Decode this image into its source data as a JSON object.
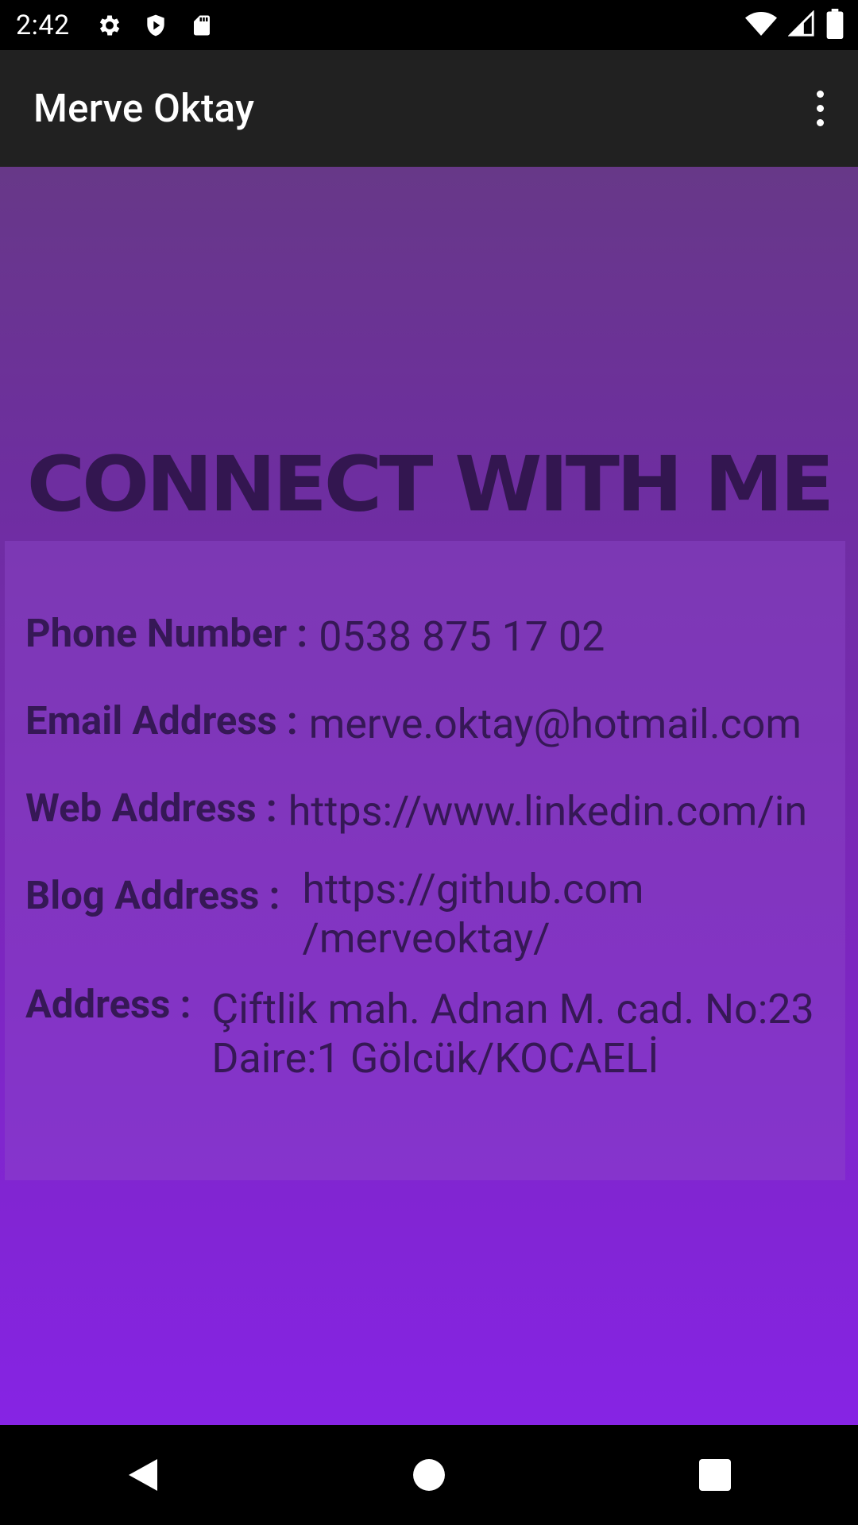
{
  "status_bar": {
    "time": "2:42",
    "icons": [
      "gear-icon",
      "shield-icon",
      "sd-card-icon",
      "wifi-icon",
      "cell-signal-icon",
      "battery-icon"
    ]
  },
  "app_bar": {
    "title": "Merve Oktay",
    "menu_icon": "more-vert-icon"
  },
  "main": {
    "heading": "CONNECT WITH ME",
    "contacts": [
      {
        "label": "Phone Number :",
        "value": "0538 875 17 02"
      },
      {
        "label": "Email Address :",
        "value": "merve.oktay@hotmail.com"
      },
      {
        "label": "Web Address :",
        "value": "https://www.linkedin.com/in"
      },
      {
        "label": "Blog Address :",
        "value_line1": "https://github.com",
        "value_line2": "/merveoktay/"
      },
      {
        "label": "Address :",
        "value_line1": "Çiftlik mah. Adnan M. cad. No:23",
        "value_line2": "Daire:1 Gölcük/KOCAELİ"
      }
    ]
  },
  "nav_bar": {
    "icons": [
      "back-icon",
      "home-icon",
      "recents-icon"
    ]
  },
  "colors": {
    "app_bar_bg": "#212121",
    "gradient_top": "#673888",
    "gradient_bottom": "#8624e4",
    "text_dark": "#361856",
    "heading": "#331650"
  }
}
